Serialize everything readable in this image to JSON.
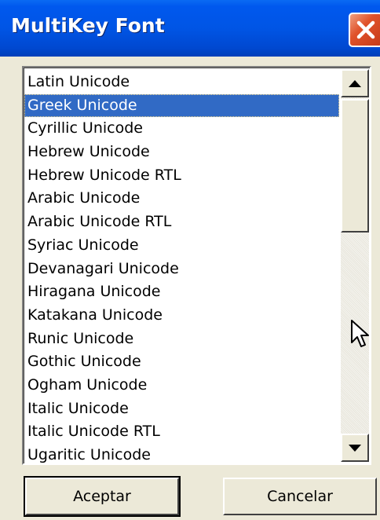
{
  "window": {
    "title": "MultiKey Font"
  },
  "listbox": {
    "selected_index": 1,
    "items": [
      "Latin Unicode",
      "Greek Unicode",
      "Cyrillic Unicode",
      "Hebrew Unicode",
      "Hebrew Unicode RTL",
      "Arabic Unicode",
      "Arabic Unicode RTL",
      "Syriac Unicode",
      "Devanagari Unicode",
      "Hiragana Unicode",
      "Katakana Unicode",
      "Runic Unicode",
      "Gothic Unicode",
      "Ogham Unicode",
      "Italic Unicode",
      "Italic Unicode RTL",
      "Ugaritic Unicode"
    ]
  },
  "buttons": {
    "accept_label": "Aceptar",
    "cancel_label": "Cancelar"
  },
  "colors": {
    "titlebar": "#0055e5",
    "selection": "#316ac5",
    "close_button": "#e0522a",
    "dialog_background": "#ece9d8"
  },
  "icons": {
    "close": "close-icon",
    "scroll_up": "arrow-up-icon",
    "scroll_down": "arrow-down-icon",
    "cursor": "mouse-pointer-icon"
  }
}
